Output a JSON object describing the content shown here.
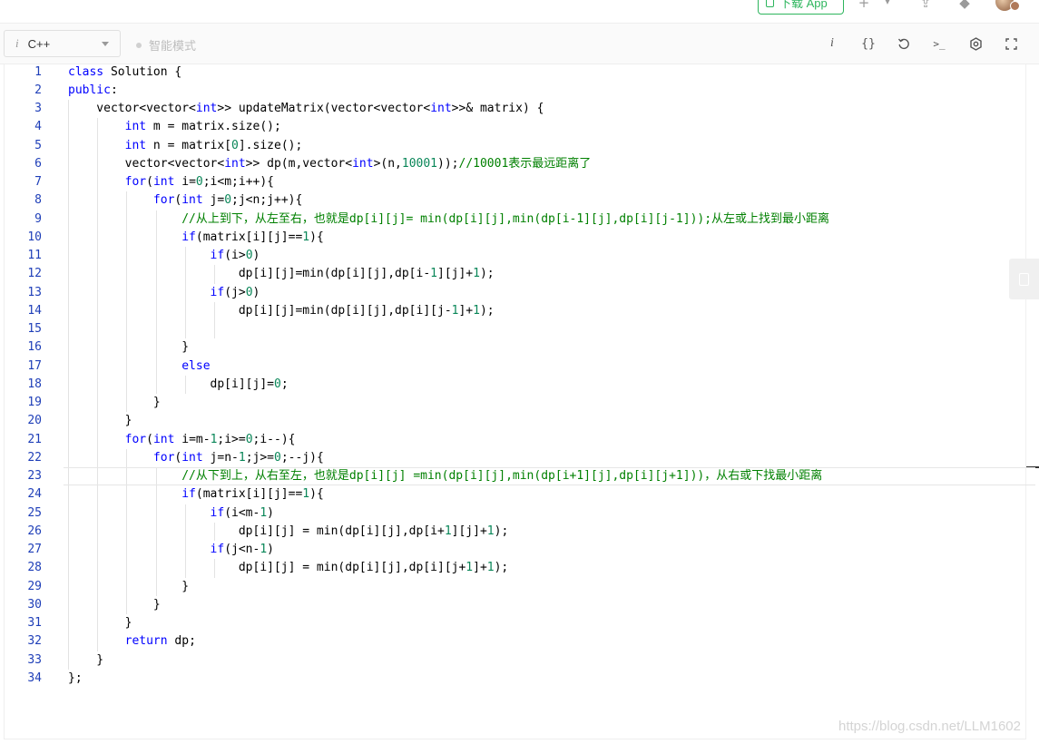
{
  "topbar": {
    "download_label": "下载 App"
  },
  "toolbar": {
    "language": "C++",
    "info_glyph": "i",
    "smart_mode_label": "智能模式",
    "buttons": {
      "info": "i",
      "format": "{}",
      "console": ">_"
    }
  },
  "editor": {
    "line_numbers": [
      "1",
      "2",
      "3",
      "4",
      "5",
      "6",
      "7",
      "8",
      "9",
      "10",
      "11",
      "12",
      "13",
      "14",
      "15",
      "16",
      "17",
      "18",
      "19",
      "20",
      "21",
      "22",
      "23",
      "24",
      "25",
      "26",
      "27",
      "28",
      "29",
      "30",
      "31",
      "32",
      "33",
      "34"
    ],
    "active_line": 23
  },
  "watermark": "https://blog.csdn.net/LLM1602",
  "colors": {
    "keyword": "#0000ff",
    "comment": "#008000",
    "number": "#098658",
    "line_number": "#1f3fb8",
    "accent_green": "#2db55d"
  },
  "code_lines": [
    [
      [
        "k",
        "class"
      ],
      [
        "p",
        " Solution {"
      ]
    ],
    [
      [
        "k",
        "public"
      ],
      [
        "p",
        ":"
      ]
    ],
    [
      [
        "p",
        "    vector<vector<"
      ],
      [
        "k",
        "int"
      ],
      [
        "p",
        ">> updateMatrix(vector<vector<"
      ],
      [
        "k",
        "int"
      ],
      [
        "p",
        ">>& matrix) {"
      ]
    ],
    [
      [
        "p",
        "        "
      ],
      [
        "k",
        "int"
      ],
      [
        "p",
        " m = matrix.size();"
      ]
    ],
    [
      [
        "p",
        "        "
      ],
      [
        "k",
        "int"
      ],
      [
        "p",
        " n = matrix["
      ],
      [
        "n",
        "0"
      ],
      [
        "p",
        "].size();"
      ]
    ],
    [
      [
        "p",
        "        vector<vector<"
      ],
      [
        "k",
        "int"
      ],
      [
        "p",
        ">> dp(m,vector<"
      ],
      [
        "k",
        "int"
      ],
      [
        "p",
        ">(n,"
      ],
      [
        "n",
        "10001"
      ],
      [
        "p",
        "));"
      ],
      [
        "c",
        "//10001表示最远距离了"
      ]
    ],
    [
      [
        "p",
        "        "
      ],
      [
        "k",
        "for"
      ],
      [
        "p",
        "("
      ],
      [
        "k",
        "int"
      ],
      [
        "p",
        " i="
      ],
      [
        "n",
        "0"
      ],
      [
        "p",
        ";i<m;i++){"
      ]
    ],
    [
      [
        "p",
        "            "
      ],
      [
        "k",
        "for"
      ],
      [
        "p",
        "("
      ],
      [
        "k",
        "int"
      ],
      [
        "p",
        " j="
      ],
      [
        "n",
        "0"
      ],
      [
        "p",
        ";j<n;j++){"
      ]
    ],
    [
      [
        "p",
        "                "
      ],
      [
        "c",
        "//从上到下，从左至右，也就是dp[i][j]= min(dp[i][j],min(dp[i-1][j],dp[i][j-1]));从左或上找到最小距离"
      ]
    ],
    [
      [
        "p",
        "                "
      ],
      [
        "k",
        "if"
      ],
      [
        "p",
        "(matrix[i][j]=="
      ],
      [
        "n",
        "1"
      ],
      [
        "p",
        "){"
      ]
    ],
    [
      [
        "p",
        "                    "
      ],
      [
        "k",
        "if"
      ],
      [
        "p",
        "(i>"
      ],
      [
        "n",
        "0"
      ],
      [
        "p",
        ")"
      ]
    ],
    [
      [
        "p",
        "                        dp[i][j]=min(dp[i][j],dp[i-"
      ],
      [
        "n",
        "1"
      ],
      [
        "p",
        "][j]+"
      ],
      [
        "n",
        "1"
      ],
      [
        "p",
        ");"
      ]
    ],
    [
      [
        "p",
        "                    "
      ],
      [
        "k",
        "if"
      ],
      [
        "p",
        "(j>"
      ],
      [
        "n",
        "0"
      ],
      [
        "p",
        ")"
      ]
    ],
    [
      [
        "p",
        "                        dp[i][j]=min(dp[i][j],dp[i][j-"
      ],
      [
        "n",
        "1"
      ],
      [
        "p",
        "]+"
      ],
      [
        "n",
        "1"
      ],
      [
        "p",
        ");"
      ]
    ],
    [
      [
        "p",
        ""
      ]
    ],
    [
      [
        "p",
        "                }"
      ]
    ],
    [
      [
        "p",
        "                "
      ],
      [
        "k",
        "else"
      ]
    ],
    [
      [
        "p",
        "                    dp[i][j]="
      ],
      [
        "n",
        "0"
      ],
      [
        "p",
        ";"
      ]
    ],
    [
      [
        "p",
        "            }"
      ]
    ],
    [
      [
        "p",
        "        }"
      ]
    ],
    [
      [
        "p",
        "        "
      ],
      [
        "k",
        "for"
      ],
      [
        "p",
        "("
      ],
      [
        "k",
        "int"
      ],
      [
        "p",
        " i=m-"
      ],
      [
        "n",
        "1"
      ],
      [
        "p",
        ";i>="
      ],
      [
        "n",
        "0"
      ],
      [
        "p",
        ";i--){"
      ]
    ],
    [
      [
        "p",
        "            "
      ],
      [
        "k",
        "for"
      ],
      [
        "p",
        "("
      ],
      [
        "k",
        "int"
      ],
      [
        "p",
        " j=n-"
      ],
      [
        "n",
        "1"
      ],
      [
        "p",
        ";j>="
      ],
      [
        "n",
        "0"
      ],
      [
        "p",
        ";--j){"
      ]
    ],
    [
      [
        "p",
        "                "
      ],
      [
        "c",
        "//从下到上，从右至左，也就是dp[i][j] =min(dp[i][j],min(dp[i+1][j],dp[i][j+1]))，从右或下找最小距离"
      ]
    ],
    [
      [
        "p",
        "                "
      ],
      [
        "k",
        "if"
      ],
      [
        "p",
        "(matrix[i][j]=="
      ],
      [
        "n",
        "1"
      ],
      [
        "p",
        "){"
      ]
    ],
    [
      [
        "p",
        "                    "
      ],
      [
        "k",
        "if"
      ],
      [
        "p",
        "(i<m-"
      ],
      [
        "n",
        "1"
      ],
      [
        "p",
        ")"
      ]
    ],
    [
      [
        "p",
        "                        dp[i][j] = min(dp[i][j],dp[i+"
      ],
      [
        "n",
        "1"
      ],
      [
        "p",
        "][j]+"
      ],
      [
        "n",
        "1"
      ],
      [
        "p",
        ");"
      ]
    ],
    [
      [
        "p",
        "                    "
      ],
      [
        "k",
        "if"
      ],
      [
        "p",
        "(j<n-"
      ],
      [
        "n",
        "1"
      ],
      [
        "p",
        ")"
      ]
    ],
    [
      [
        "p",
        "                        dp[i][j] = min(dp[i][j],dp[i][j+"
      ],
      [
        "n",
        "1"
      ],
      [
        "p",
        "]+"
      ],
      [
        "n",
        "1"
      ],
      [
        "p",
        ");"
      ]
    ],
    [
      [
        "p",
        "                }"
      ]
    ],
    [
      [
        "p",
        "            }"
      ]
    ],
    [
      [
        "p",
        "        }"
      ]
    ],
    [
      [
        "p",
        "        "
      ],
      [
        "k",
        "return"
      ],
      [
        "p",
        " dp;"
      ]
    ],
    [
      [
        "p",
        "    }"
      ]
    ],
    [
      [
        "p",
        "};"
      ]
    ]
  ]
}
